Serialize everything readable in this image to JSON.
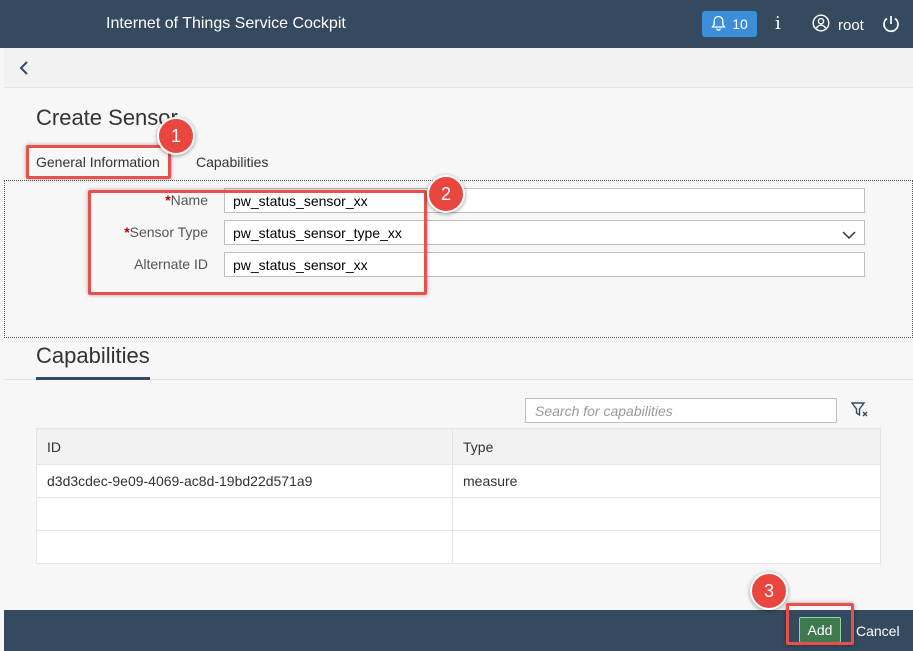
{
  "shell": {
    "title": "Internet of Things Service Cockpit",
    "notifications_count": "10",
    "user": "root",
    "colors": {
      "bar": "#354a5f",
      "notification": "#3c8ed8"
    }
  },
  "icons": [
    "bell-icon",
    "info-icon",
    "user-icon",
    "power-icon",
    "back-icon",
    "chevron-down-icon",
    "filter-clear-icon"
  ],
  "page": {
    "title": "Create Sensor",
    "tabs": [
      {
        "label": "General Information",
        "selected": true
      },
      {
        "label": "Capabilities",
        "selected": false
      }
    ]
  },
  "form": {
    "name": {
      "label": "Name",
      "required": true,
      "value": "pw_status_sensor_xx"
    },
    "sensor_type": {
      "label": "Sensor Type",
      "required": true,
      "value": "pw_status_sensor_type_xx"
    },
    "alternate_id": {
      "label": "Alternate ID",
      "required": false,
      "value": "pw_status_sensor_xx"
    }
  },
  "capabilities": {
    "heading": "Capabilities",
    "search_placeholder": "Search for capabilities",
    "columns": [
      "ID",
      "Type"
    ],
    "rows": [
      {
        "id": "d3d3cdec-9e09-4069-ac8d-19bd22d571a9",
        "type": "measure"
      },
      {
        "id": "",
        "type": ""
      },
      {
        "id": "",
        "type": ""
      }
    ]
  },
  "footer": {
    "add_label": "Add",
    "cancel_label": "Cancel"
  },
  "annotations": {
    "step1": "1",
    "step2": "2",
    "step3": "3",
    "color": "#e8463f"
  }
}
